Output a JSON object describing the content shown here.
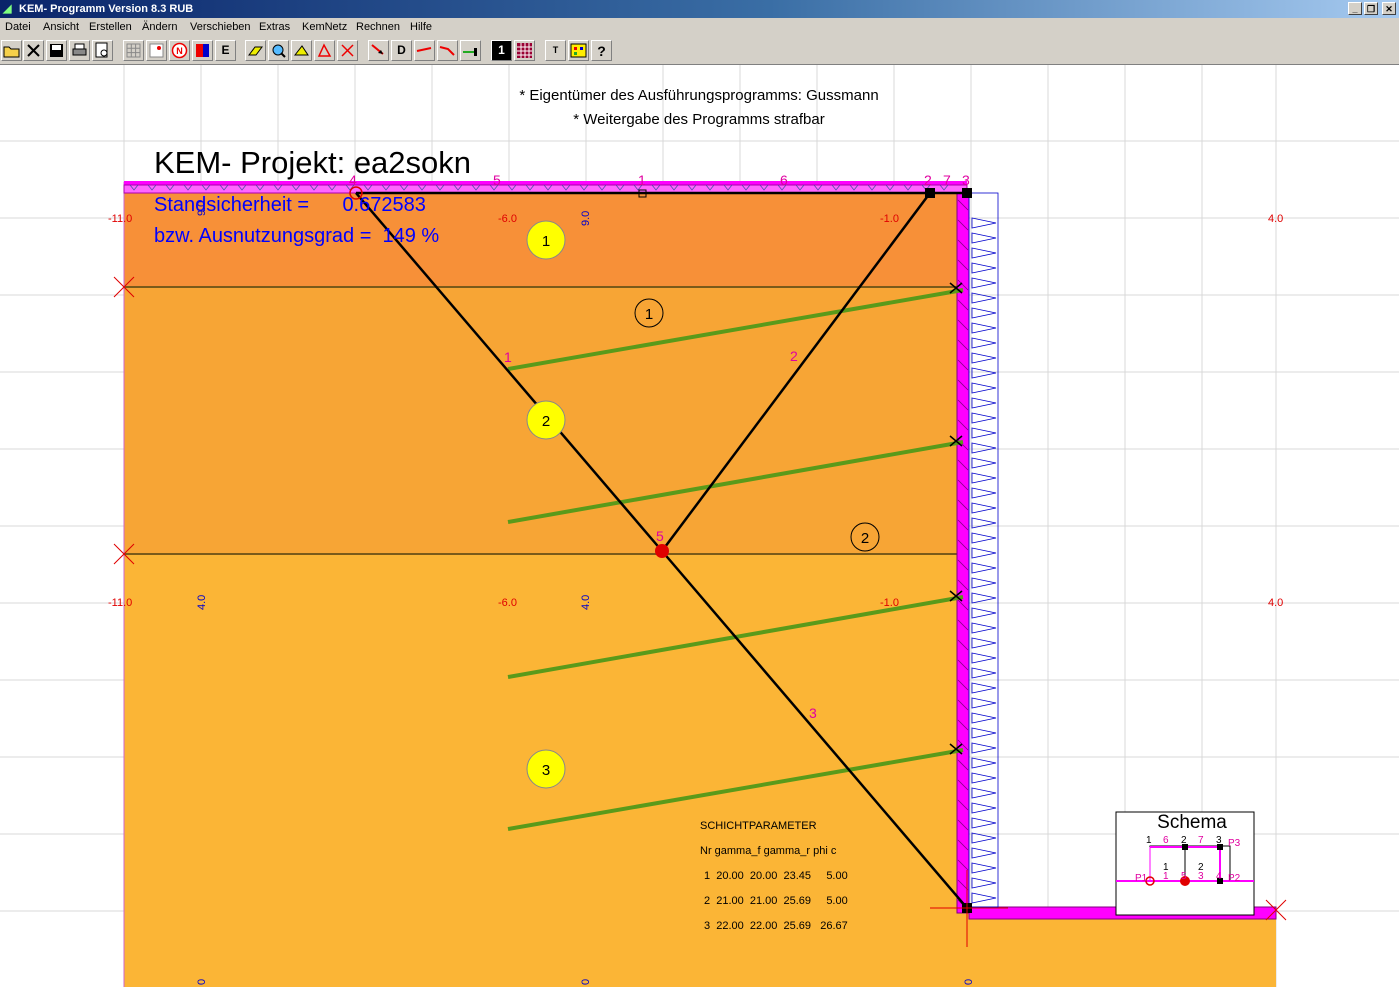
{
  "window": {
    "title": "KEM- Programm Version 8.3 RUB",
    "minimize": "_",
    "restore": "❐",
    "close": "✕"
  },
  "menu": [
    "Datei",
    "Ansicht",
    "Erstellen",
    "Ändern",
    "Verschieben",
    "Extras",
    "KemNetz",
    "Rechnen",
    "Hilfe"
  ],
  "toolbar": [
    "open-icon",
    "close-file-icon",
    "save-icon",
    "print-icon",
    "preview-icon",
    "grid-icon",
    "point-icon",
    "node-icon",
    "color-icon",
    "E",
    "edit-icon",
    "zoom-icon",
    "move-icon",
    "angle-icon",
    "delete-icon",
    "arrow-icon",
    "D",
    "line-icon",
    "curve-icon",
    "anchor-icon",
    "1",
    "table-icon",
    "text-icon",
    "layer-icon",
    "help-icon"
  ],
  "toolbar_labels": {
    "E": "E",
    "D": "D",
    "one": "1",
    "text": "T"
  },
  "drawing": {
    "notice1": "* Eigentümer des Ausführungsprogramms: Gussmann",
    "notice2": "* Weitergabe des Programms strafbar",
    "project_title": "KEM- Projekt: ea2sokn",
    "safety_line": "Standsicherheit =      0.672583",
    "utilization_line": "bzw. Ausnutzungsgrad =  149 %",
    "axis_labels": [
      "-11.0",
      "-6.0",
      "-1.0",
      "4.0",
      "9.0",
      "4.0",
      "0"
    ],
    "node_labels": [
      "1",
      "2",
      "3",
      "4",
      "5",
      "6",
      "7"
    ],
    "layer_labels": [
      "1",
      "2",
      "3"
    ],
    "schichtparameter": {
      "title": "SCHICHTPARAMETER",
      "header": "Nr gamma_f gamma_r phi c",
      "rows": [
        "1  20.00  20.00  23.45     5.00",
        "2  21.00  21.00  25.69     5.00",
        "3  22.00  22.00  25.69   26.67"
      ]
    },
    "schema": {
      "title": "Schema",
      "labels": [
        "1",
        "6",
        "2",
        "7",
        "3",
        "P3",
        "P1",
        "1",
        "5",
        "3",
        "2",
        "P2",
        "4"
      ]
    },
    "colors": {
      "layer1": "#f79038",
      "layer2": "#f7a535",
      "layer3": "#fbb536",
      "wall": "#ff00ff",
      "anchor": "#5a9a1a",
      "load": "#0000cc"
    }
  }
}
